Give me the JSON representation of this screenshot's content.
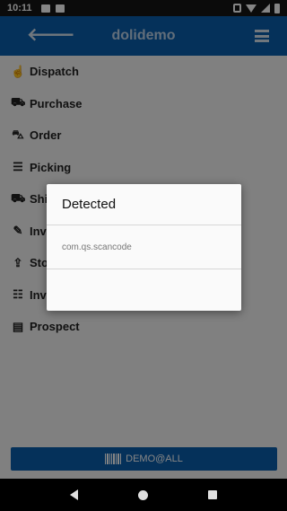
{
  "status_bar": {
    "time": "10:11"
  },
  "app_bar": {
    "title": "dolidemo",
    "back_glyph": "🡐",
    "icons": [
      "arrow-left-icon",
      "hamburger-menu-icon"
    ]
  },
  "menu": [
    {
      "label": "Dispatch",
      "icon": "handshake-icon",
      "glyph": "☝"
    },
    {
      "label": "Purchase",
      "icon": "basket-icon",
      "glyph": "⛟"
    },
    {
      "label": "Order",
      "icon": "cart-icon",
      "glyph": "⛍"
    },
    {
      "label": "Picking",
      "icon": "list-icon",
      "glyph": "☰"
    },
    {
      "label": "Shipping",
      "icon": "truck-icon",
      "glyph": "⛟"
    },
    {
      "label": "Inventory",
      "icon": "edit-icon",
      "glyph": "✎"
    },
    {
      "label": "Stock",
      "icon": "export-icon",
      "glyph": "⇪"
    },
    {
      "label": "Inventory list",
      "icon": "ordered-list-icon",
      "glyph": "☷"
    },
    {
      "label": "Prospect",
      "icon": "id-card-icon",
      "glyph": "▤"
    }
  ],
  "bottom_button": {
    "label": "DEMO@ALL",
    "icon": "barcode-icon"
  },
  "dialog": {
    "title": "Detected",
    "message": "com.qs.scancode"
  },
  "colors": {
    "primary": "#0b5fad",
    "background": "#f5f5f5",
    "scrim": "rgba(0,0,0,0.48)"
  }
}
